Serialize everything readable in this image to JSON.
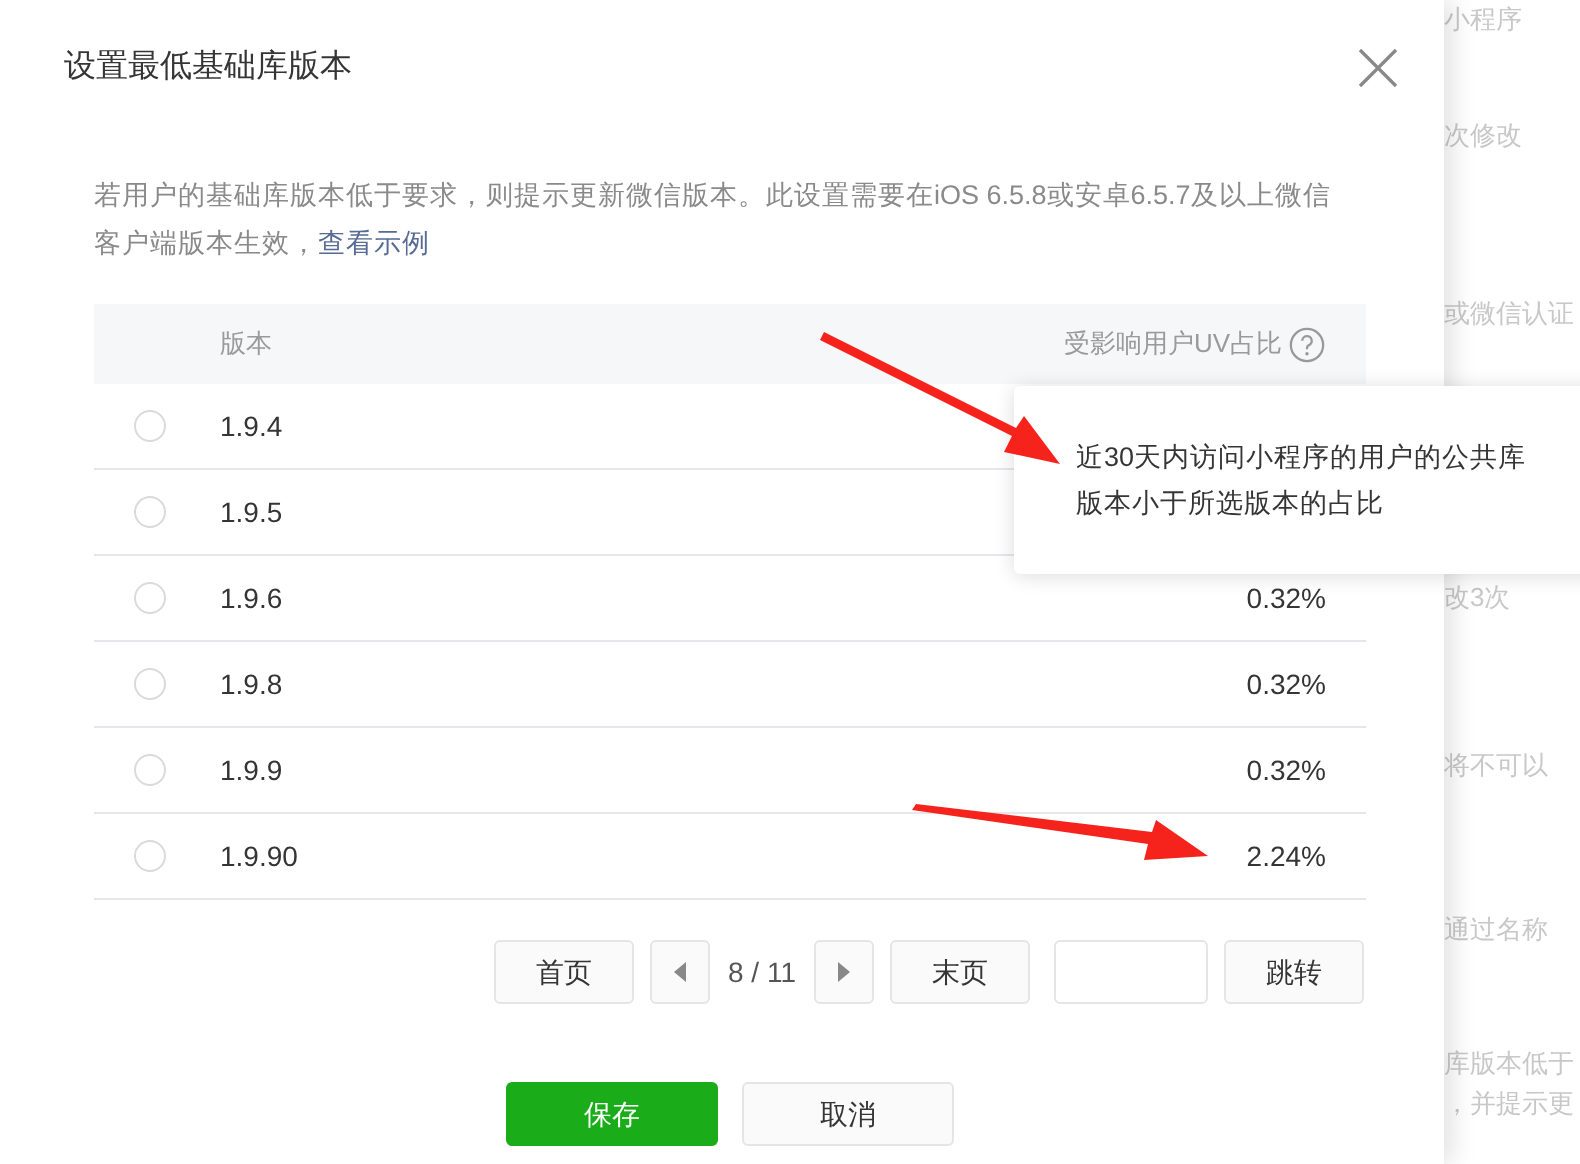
{
  "background_page": {
    "lines": [
      "小程序",
      "次修改",
      "或微信认证",
      "改3次",
      "将不可以",
      "通过名称",
      "库版本低于",
      "，并提示更"
    ]
  },
  "dialog": {
    "title": "设置最低基础库版本",
    "description": "若用户的基础库版本低于要求，则提示更新微信版本。此设置需要在iOS 6.5.8或安卓6.5.7及以上微信客户端版本生效，",
    "example_link": "查看示例",
    "table": {
      "columns": [
        "版本",
        "受影响用户UV占比"
      ],
      "rows": [
        {
          "version": "1.9.4",
          "selected": false
        },
        {
          "version": "1.9.5",
          "selected": false
        },
        {
          "version": "1.9.6",
          "uv_share": "0.32%",
          "selected": false
        },
        {
          "version": "1.9.8",
          "uv_share": "0.32%",
          "selected": false
        },
        {
          "version": "1.9.9",
          "uv_share": "0.32%",
          "selected": false
        },
        {
          "version": "1.9.90",
          "uv_share": "2.24%",
          "selected": false
        }
      ]
    },
    "tooltip": {
      "lines": [
        "近30天内访问小程序的用户的公共库",
        "版本小于所选版本的占比"
      ]
    },
    "pagination": {
      "first": "首页",
      "page": "8 / 11",
      "last": "末页",
      "jump": "跳转"
    },
    "buttons": [
      {
        "label": "保存",
        "kind": "primary"
      },
      {
        "label": "取消",
        "kind": "default"
      }
    ]
  }
}
